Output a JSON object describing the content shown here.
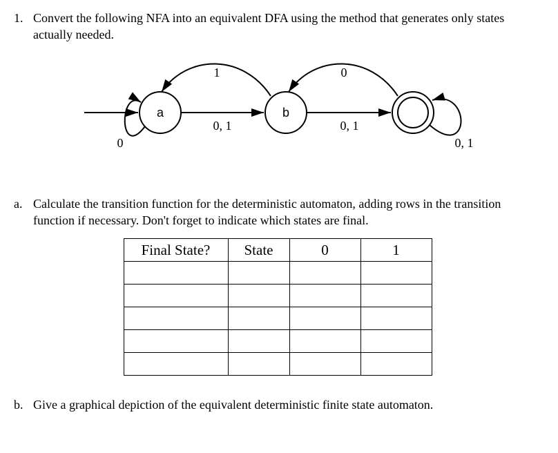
{
  "question": {
    "number": "1.",
    "text": "Convert the following NFA into an equivalent DFA using the method that generates only states actually needed."
  },
  "nfa": {
    "states": {
      "a": "a",
      "b": "b"
    },
    "edge_a_self": "0",
    "edge_b_to_a": "1",
    "edge_a_to_b": "0, 1",
    "edge_c_to_b": "0",
    "edge_b_to_c": "0, 1",
    "edge_c_self": "0, 1"
  },
  "parts": {
    "a": {
      "label": "a.",
      "text": "Calculate the transition function for the deterministic automaton, adding rows in the transition function if necessary. Don't forget to indicate which states are final."
    },
    "b": {
      "label": "b.",
      "text": "Give a graphical depiction of the equivalent deterministic finite state automaton."
    }
  },
  "table": {
    "headers": {
      "final": "Final State?",
      "state": "State",
      "sym0": "0",
      "sym1": "1"
    },
    "rows": 5
  }
}
